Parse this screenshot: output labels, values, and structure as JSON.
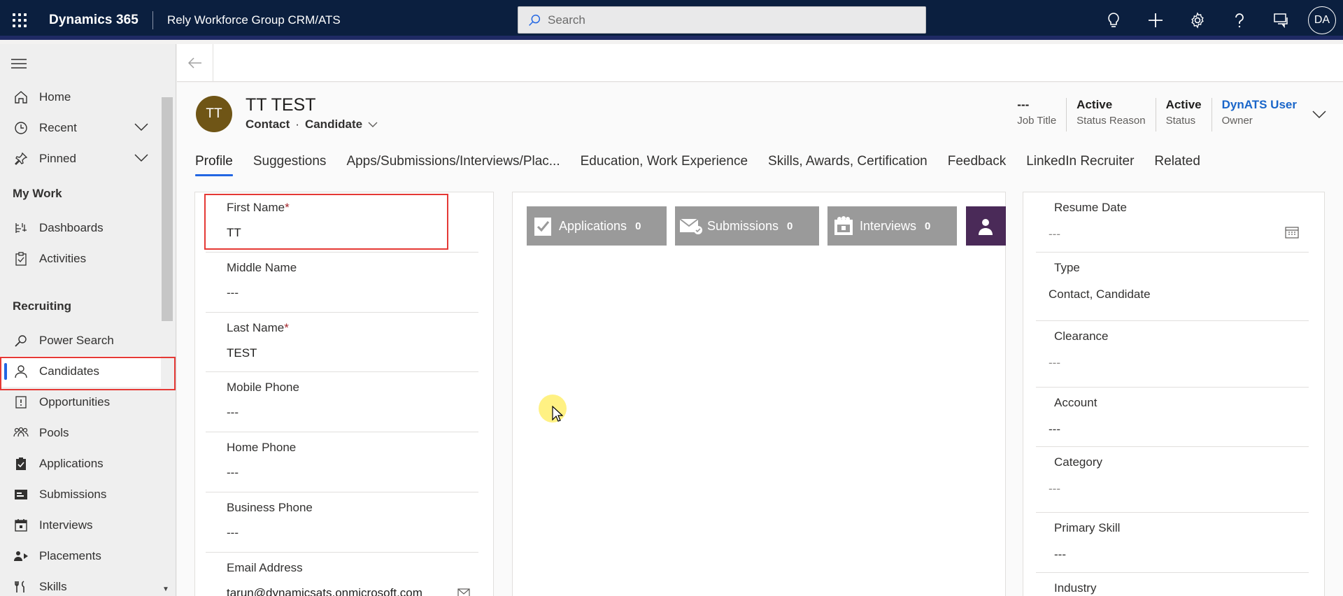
{
  "topbar": {
    "brand": "Dynamics 365",
    "app_name": "Rely Workforce Group CRM/ATS",
    "search_placeholder": "Search",
    "user_initials": "DA"
  },
  "nav": {
    "home": "Home",
    "recent": "Recent",
    "pinned": "Pinned",
    "my_work_heading": "My Work",
    "dashboards": "Dashboards",
    "activities": "Activities",
    "recruiting_heading": "Recruiting",
    "power_search": "Power Search",
    "candidates": "Candidates",
    "opportunities": "Opportunities",
    "pools": "Pools",
    "applications": "Applications",
    "submissions": "Submissions",
    "interviews": "Interviews",
    "placements": "Placements",
    "skills": "Skills"
  },
  "record": {
    "initials": "TT",
    "name": "TT TEST",
    "entity": "Contact",
    "separator": "·",
    "form": "Candidate"
  },
  "header_fields": {
    "job_title_value": "---",
    "job_title_label": "Job Title",
    "status_reason_value": "Active",
    "status_reason_label": "Status Reason",
    "status_value": "Active",
    "status_label": "Status",
    "owner_value": "DynATS User",
    "owner_label": "Owner"
  },
  "tabs": {
    "profile": "Profile",
    "suggestions": "Suggestions",
    "apps": "Apps/Submissions/Interviews/Plac...",
    "education": "Education, Work Experience",
    "skills": "Skills, Awards, Certification",
    "feedback": "Feedback",
    "linkedin": "LinkedIn Recruiter",
    "related": "Related"
  },
  "left_fields": {
    "first_name_label": "First Name",
    "first_name_req": "*",
    "first_name_value": "TT",
    "middle_name_label": "Middle Name",
    "middle_name_value": "---",
    "last_name_label": "Last Name",
    "last_name_req": "*",
    "last_name_value": "TEST",
    "mobile_phone_label": "Mobile Phone",
    "mobile_phone_value": "---",
    "home_phone_label": "Home Phone",
    "home_phone_value": "---",
    "business_phone_label": "Business Phone",
    "business_phone_value": "---",
    "email_label": "Email Address",
    "email_value": "tarun@dynamicsats.onmicrosoft.com"
  },
  "tiles": {
    "applications_label": "Applications",
    "applications_count": "0",
    "submissions_label": "Submissions",
    "submissions_count": "0",
    "interviews_label": "Interviews",
    "interviews_count": "0"
  },
  "right_fields": {
    "resume_date_label": "Resume Date",
    "resume_date_value": "---",
    "type_label": "Type",
    "type_value": "Contact, Candidate",
    "clearance_label": "Clearance",
    "clearance_value": "---",
    "account_label": "Account",
    "account_value": "---",
    "category_label": "Category",
    "category_value": "---",
    "primary_skill_label": "Primary Skill",
    "primary_skill_value": "---",
    "industry_label": "Industry"
  }
}
